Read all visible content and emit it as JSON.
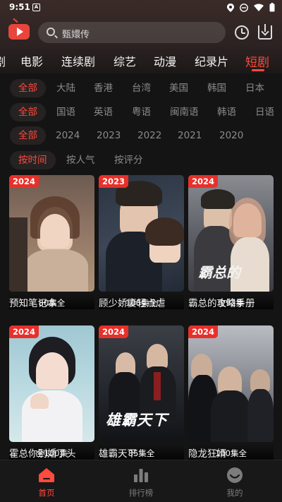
{
  "status_bar": {
    "time": "9:51",
    "notif_letter": "A"
  },
  "search": {
    "placeholder": "甄嬛传"
  },
  "categories": [
    {
      "label": "剧"
    },
    {
      "label": "电影"
    },
    {
      "label": "连续剧"
    },
    {
      "label": "综艺"
    },
    {
      "label": "动漫"
    },
    {
      "label": "纪录片"
    },
    {
      "label": "短剧",
      "active": true
    }
  ],
  "filters": {
    "region": [
      "全部",
      "大陆",
      "香港",
      "台湾",
      "美国",
      "韩国",
      "日本"
    ],
    "language": [
      "全部",
      "国语",
      "英语",
      "粤语",
      "闽南语",
      "韩语",
      "日语"
    ],
    "year": [
      "全部",
      "2024",
      "2023",
      "2022",
      "2021",
      "2020"
    ],
    "sort": [
      "按时间",
      "按人气",
      "按评分"
    ]
  },
  "cards": [
    {
      "year": "2024",
      "episodes": "80集全",
      "title": "预知笔记本"
    },
    {
      "year": "2023",
      "episodes": "100集全",
      "title": "顾少娇妻轻点虐"
    },
    {
      "year": "2024",
      "episodes": "全92集",
      "title": "霸总的攻略手册",
      "poster_text": "霸总的"
    },
    {
      "year": "2024",
      "episodes": "全100集",
      "title": "霍总你别婚了头"
    },
    {
      "year": "2024",
      "episodes": "85集全",
      "title": "雄霸天下",
      "poster_text": "雄霸天下"
    },
    {
      "year": "2024",
      "episodes": "100集全",
      "title": "隐龙狂婿"
    }
  ],
  "bottom_nav": [
    {
      "label": "首页",
      "active": true
    },
    {
      "label": "排行榜"
    },
    {
      "label": "我的"
    }
  ],
  "colors": {
    "accent": "#ff4a3d",
    "badge": "#e8302a",
    "background": "#141414"
  }
}
